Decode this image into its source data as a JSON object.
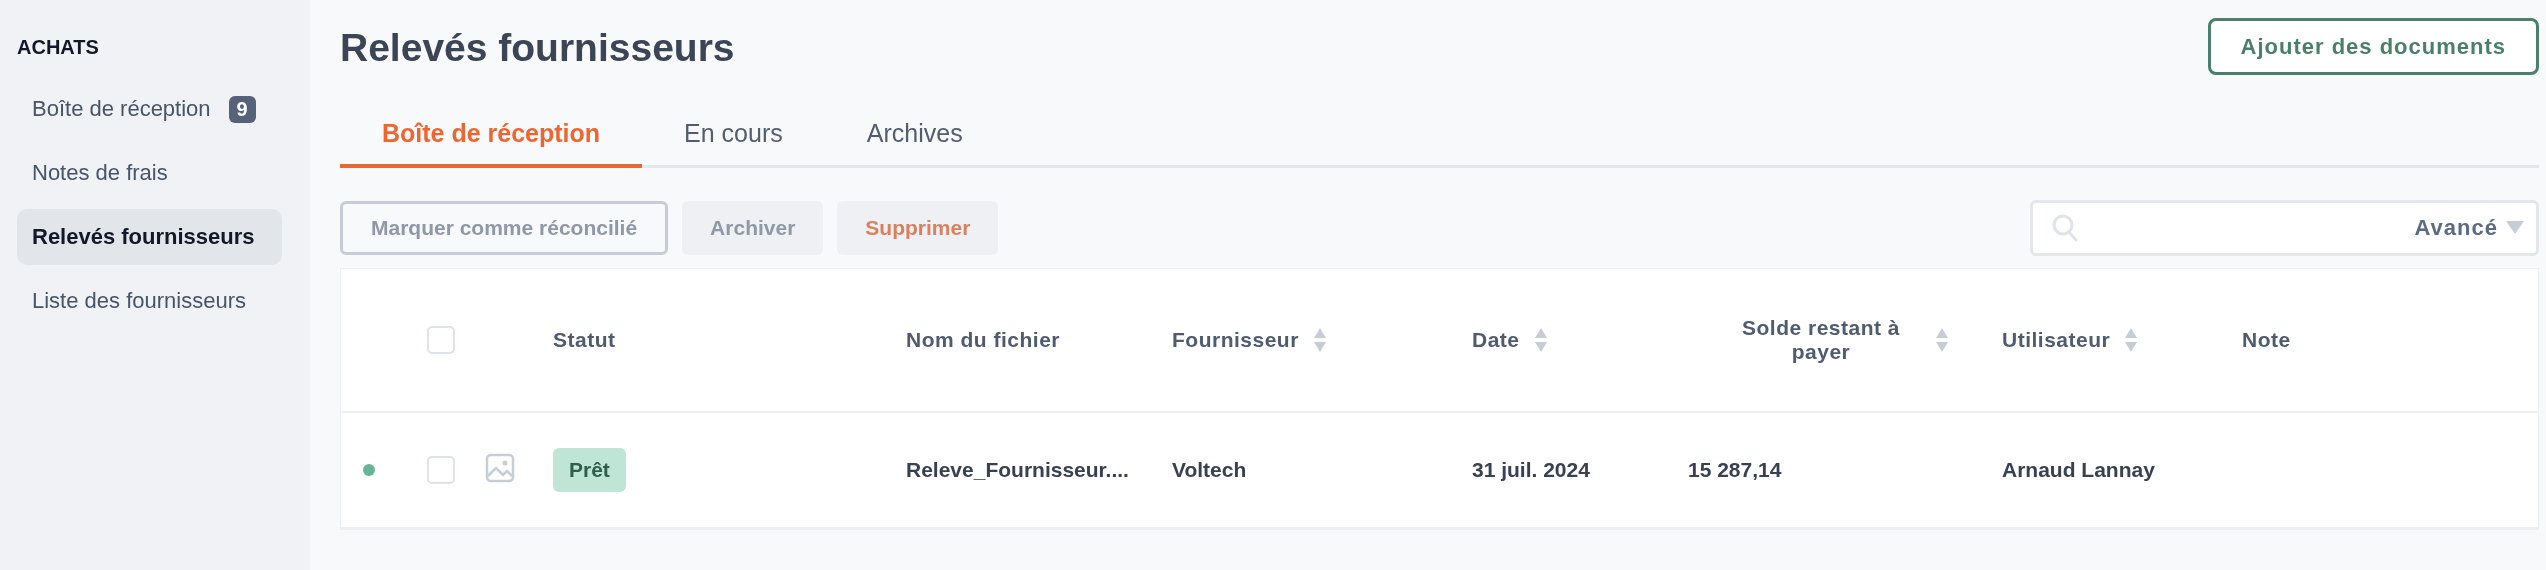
{
  "sidebar": {
    "section": "ACHATS",
    "items": [
      {
        "label": "Boîte de réception",
        "badge": "9",
        "selected": false
      },
      {
        "label": "Notes de frais",
        "selected": false
      },
      {
        "label": "Relevés fournisseurs",
        "selected": true
      },
      {
        "label": "Liste des fournisseurs",
        "selected": false
      }
    ]
  },
  "page_title": "Relevés fournisseurs",
  "add_button": "Ajouter des documents",
  "tabs": [
    {
      "label": "Boîte de réception",
      "selected": true
    },
    {
      "label": "En cours",
      "selected": false
    },
    {
      "label": "Archives",
      "selected": false
    }
  ],
  "actions": [
    {
      "label": "Marquer comme réconcilié",
      "kind": "outline",
      "disabled": true
    },
    {
      "label": "Archiver",
      "kind": "plain",
      "disabled": true
    },
    {
      "label": "Supprimer",
      "kind": "danger",
      "disabled": true
    }
  ],
  "search": {
    "advanced": "Avancé"
  },
  "table": {
    "select_all_checked": false,
    "columns": [
      {
        "label": "Statut",
        "sortable": false
      },
      {
        "label": "Nom du fichier",
        "sortable": false
      },
      {
        "label": "Fournisseur",
        "sortable": true
      },
      {
        "label": "Date",
        "sortable": true
      },
      {
        "label": "Solde restant à payer",
        "sortable": true
      },
      {
        "label": "Utilisateur",
        "sortable": true
      },
      {
        "label": "Note",
        "sortable": false
      }
    ],
    "rows": [
      {
        "unread": true,
        "checked": false,
        "status": "Prêt",
        "file": "Releve_Fournisseur....",
        "supplier": "Voltech",
        "date": "31 juil. 2024",
        "balance": "15 287,14",
        "user": "Arnaud Lannay"
      }
    ]
  }
}
